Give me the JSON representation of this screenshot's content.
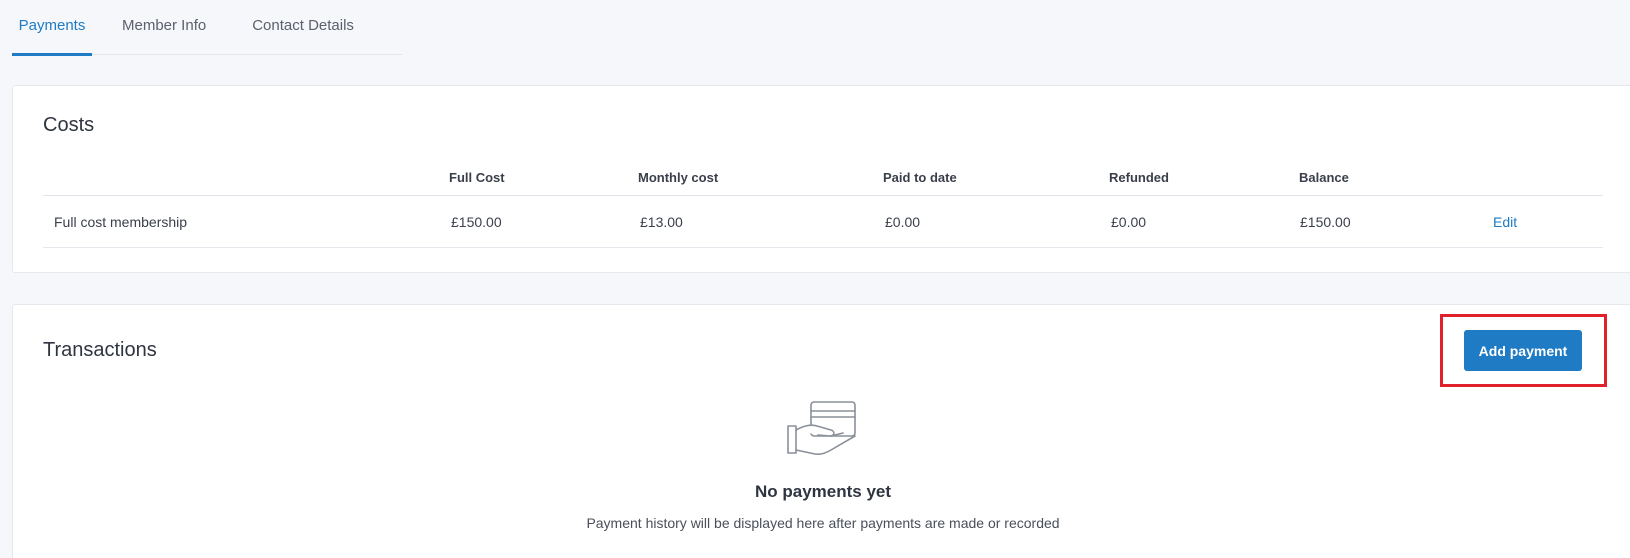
{
  "tabs": [
    {
      "label": "Payments",
      "active": true
    },
    {
      "label": "Member Info",
      "active": false
    },
    {
      "label": "Contact Details",
      "active": false
    }
  ],
  "costs": {
    "title": "Costs",
    "headers": {
      "full_cost": "Full Cost",
      "monthly_cost": "Monthly cost",
      "paid_to_date": "Paid to date",
      "refunded": "Refunded",
      "balance": "Balance"
    },
    "rows": [
      {
        "label": "Full cost membership",
        "full_cost": "£150.00",
        "monthly_cost": "£13.00",
        "paid_to_date": "£0.00",
        "refunded": "£0.00",
        "balance": "£150.00",
        "action": "Edit"
      }
    ]
  },
  "transactions": {
    "title": "Transactions",
    "add_button_label": "Add payment",
    "empty_icon": "card-in-hand-icon",
    "empty_title": "No payments yet",
    "empty_description": "Payment history will be displayed here after payments are made or recorded"
  },
  "colors": {
    "accent": "#1e7bc4",
    "highlight": "#e0202a",
    "background": "#f6f7fb"
  }
}
